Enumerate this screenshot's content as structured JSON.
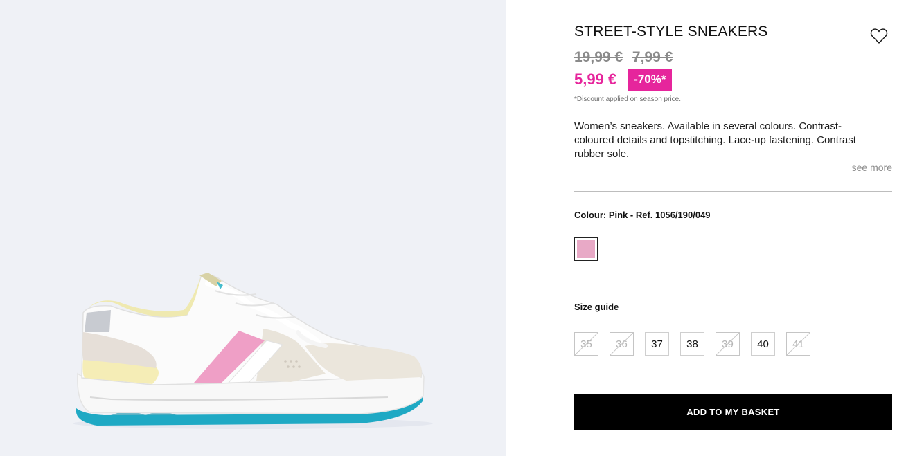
{
  "product": {
    "title": "STREET-STYLE SNEAKERS",
    "old_prices": [
      "19,99 €",
      "7,99 €"
    ],
    "current_price": "5,99 €",
    "discount_badge": "-70%*",
    "discount_note": "*Discount applied on season price.",
    "description": "Women’s sneakers. Available in several colours. Contrast-coloured details and topstitching. Lace-up fastening. Contrast rubber sole.",
    "see_more_label": "see more",
    "favourite_icon": "heart-outline-icon",
    "image_alt": "White sneaker with pink stripe, yellow heel and turquoise sole"
  },
  "colour": {
    "label": "Colour: Pink - Ref. 1056/190/049",
    "swatches": [
      {
        "name": "Pink",
        "hex": "#e8a9c6",
        "selected": true
      }
    ]
  },
  "sizes": {
    "guide_label": "Size guide",
    "items": [
      {
        "label": "35",
        "available": false
      },
      {
        "label": "36",
        "available": false
      },
      {
        "label": "37",
        "available": true
      },
      {
        "label": "38",
        "available": true
      },
      {
        "label": "39",
        "available": false
      },
      {
        "label": "40",
        "available": true
      },
      {
        "label": "41",
        "available": false
      }
    ]
  },
  "cta": {
    "add_to_basket_label": "ADD TO MY BASKET"
  },
  "colors": {
    "accent_pink": "#e6259c",
    "button_bg": "#000000",
    "gallery_bg": "#eff1f6"
  }
}
